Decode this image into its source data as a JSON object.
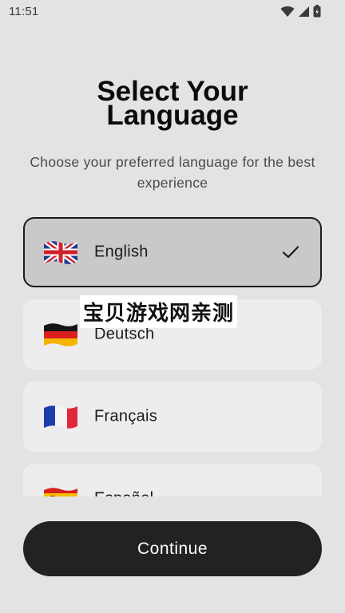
{
  "status_bar": {
    "time": "11:51",
    "icons": [
      "wifi-icon",
      "cellular-signal-icon",
      "battery-icon"
    ]
  },
  "header": {
    "title_line1": "Select Your",
    "title_line2": "Language",
    "subtitle": "Choose your preferred language for the best experience"
  },
  "languages": [
    {
      "label": "English",
      "flag": "uk-flag",
      "selected": true
    },
    {
      "label": "Deutsch",
      "flag": "germany-flag",
      "selected": false
    },
    {
      "label": "Français",
      "flag": "france-flag",
      "selected": false
    },
    {
      "label": "Español",
      "flag": "spain-flag",
      "selected": false
    }
  ],
  "watermark": "宝贝游戏网亲测",
  "continue_button": {
    "label": "Continue"
  },
  "colors": {
    "background": "#e3e3e3",
    "item_bg": "#ededed",
    "selected_item_bg": "#c9c9c9",
    "button_bg": "#222222",
    "button_text": "#ffffff"
  }
}
